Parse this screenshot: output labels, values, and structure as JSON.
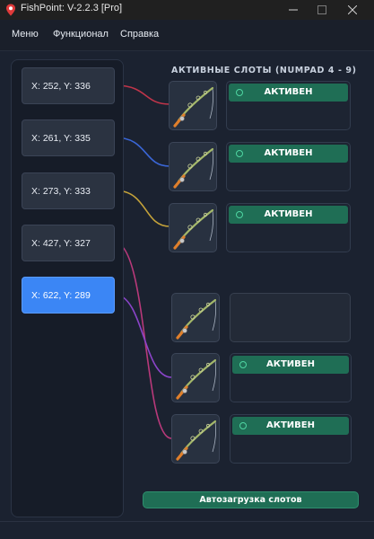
{
  "window": {
    "title": "FishPoint: V-2.2.3 [Pro]"
  },
  "menu": {
    "items": [
      "Меню",
      "Функционал",
      "Справка"
    ]
  },
  "coords": [
    {
      "label": "X: 252, Y: 336",
      "selected": false,
      "wire_color": "#c0354a"
    },
    {
      "label": "X: 261, Y: 335",
      "selected": false,
      "wire_color": "#3a66d6"
    },
    {
      "label": "X: 273, Y: 333",
      "selected": false,
      "wire_color": "#c4a23a"
    },
    {
      "label": "X: 427, Y: 327",
      "selected": false,
      "wire_color": "#b8397a"
    },
    {
      "label": "X: 622, Y: 289",
      "selected": true,
      "wire_color": "#8a44c8"
    }
  ],
  "section": {
    "title": "АКТИВНЫЕ СЛОТЫ (NUMPAD 4 - 9)"
  },
  "slots": [
    {
      "status": "АКТИВЕН",
      "active": true
    },
    {
      "status": "АКТИВЕН",
      "active": true
    },
    {
      "status": "АКТИВЕН",
      "active": true
    },
    {
      "status": "",
      "active": false
    },
    {
      "status": "АКТИВЕН",
      "active": true
    },
    {
      "status": "АКТИВЕН",
      "active": true
    }
  ],
  "buttons": {
    "autoload": "Автозагрузка слотов"
  },
  "colors": {
    "accent": "#3b86f5",
    "active_green": "#1f6e55",
    "background": "#1b2230"
  },
  "icons": {
    "app": "fish-pin-icon",
    "slot": "fishing-rod-icon"
  }
}
